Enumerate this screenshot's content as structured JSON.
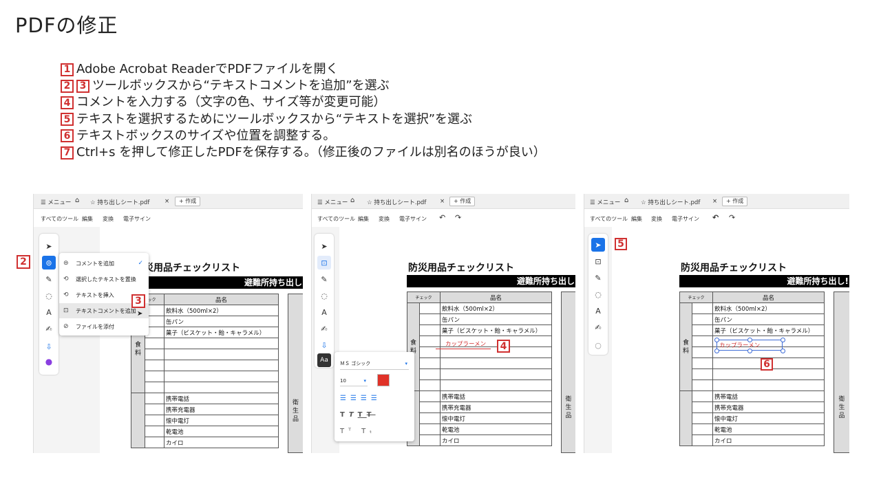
{
  "slide": {
    "title": "PDFの修正",
    "steps": [
      {
        "badges": [
          "1"
        ],
        "text": "Adobe Acrobat ReaderでPDFファイルを開く"
      },
      {
        "badges": [
          "2",
          "3"
        ],
        "text": "ツールボックスから“テキストコメントを追加”を選ぶ"
      },
      {
        "badges": [
          "4"
        ],
        "text": "コメントを入力する（文字の色、サイズ等が変更可能）"
      },
      {
        "badges": [
          "5"
        ],
        "text": "テキストを選択するためにツールボックスから“テキストを選択”を選ぶ"
      },
      {
        "badges": [
          "6"
        ],
        "text": "テキストボックスのサイズや位置を調整する。"
      },
      {
        "badges": [
          "7"
        ],
        "text": "Ctrl+s を押して修正したPDFを保存する。（修正後のファイルは別名のほうが良い）"
      }
    ]
  },
  "app": {
    "menu_label": "メニュー",
    "tab_name": "持ち出しシート.pdf",
    "close_glyph": "×",
    "new_tab_label": "+ 作成",
    "toolbar": [
      "すべてのツール",
      "編集",
      "変換",
      "電子サイン"
    ],
    "undo_glyph": "↶",
    "redo_glyph": "↷"
  },
  "document": {
    "title": "防災用品チェックリスト",
    "title_partial": "災用品チェックリスト",
    "band": "避難所持ち出し",
    "band_p3": "避難所持ち出し!",
    "col_check": "チェック",
    "col_item": "品名",
    "category_food": "食料",
    "category_hygiene": "衛生品",
    "food_items": [
      "飲料水（500ml×2）",
      "缶パン",
      "菓子（ビスケット・飴・キャラメル）",
      "",
      "",
      "",
      "",
      ""
    ],
    "other_items": [
      "携帯電話",
      "携帯充電器",
      "懐中電灯",
      "乾電池",
      "カイロ"
    ]
  },
  "menu": {
    "items": [
      {
        "icon": "⊜",
        "label": "コメントを追加",
        "checked": true
      },
      {
        "icon": "⟲",
        "label": "選択したテキストを置換"
      },
      {
        "icon": "⟲",
        "label": "テキストを挿入"
      },
      {
        "icon": "⊡",
        "label": "テキストコメントを追加",
        "highlighted": true
      },
      {
        "icon": "⊘",
        "label": "ファイルを添付"
      }
    ],
    "check_glyph": "✓"
  },
  "format_panel": {
    "font": "ＭＳ ゴシック",
    "size": "10",
    "text_color": "#e03228"
  },
  "comment": {
    "text": "カップラーメン"
  },
  "callouts": {
    "p1_rail": "2",
    "p1_menu": "3",
    "p2": "4",
    "p3_tool": "5",
    "p3_box": "6"
  },
  "colors": {
    "accent": "#1a73e8",
    "badge": "#d03030"
  }
}
